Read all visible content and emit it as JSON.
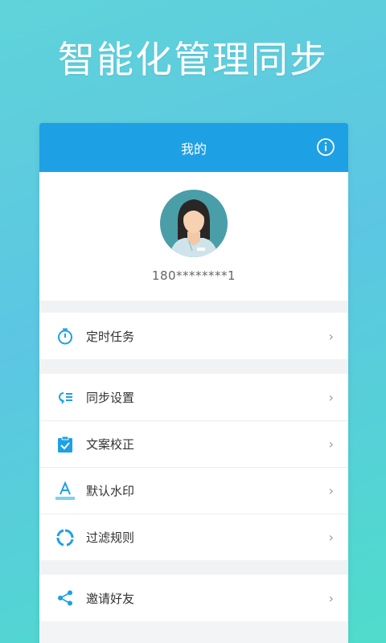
{
  "headline": "智能化管理同步",
  "appbar": {
    "title": "我的",
    "info_icon": "info-icon"
  },
  "profile": {
    "phone": "180********1"
  },
  "menu_groups": [
    [
      {
        "label": "定时任务",
        "icon": "timer-icon"
      }
    ],
    [
      {
        "label": "同步设置",
        "icon": "sync-settings-icon"
      },
      {
        "label": "文案校正",
        "icon": "clipboard-check-icon"
      },
      {
        "label": "默认水印",
        "icon": "watermark-icon"
      },
      {
        "label": "过滤规则",
        "icon": "filter-rule-icon"
      }
    ],
    [
      {
        "label": "邀请好友",
        "icon": "share-icon"
      }
    ]
  ],
  "colors": {
    "accent": "#1ea0e4",
    "icon": "#1ea0e4"
  }
}
